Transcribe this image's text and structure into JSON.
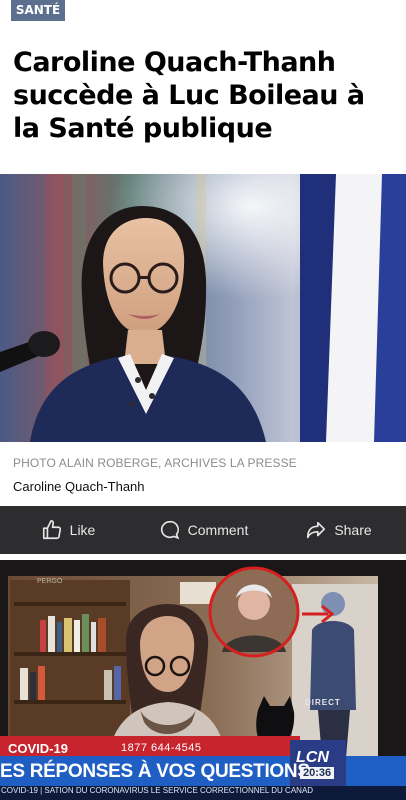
{
  "article": {
    "section_tag": "SANTÉ",
    "headline": "Caroline Quach-Thanh succède à Luc Boileau à la Santé publique",
    "photo_credit": "PHOTO ALAIN ROBERGE, ARCHIVES LA PRESSE",
    "photo_caption": "Caroline Quach-Thanh"
  },
  "social_bar": {
    "like_label": "Like",
    "comment_label": "Comment",
    "share_label": "Share",
    "icons": [
      "thumbs-up-icon",
      "speech-bubble-icon",
      "share-arrow-icon"
    ]
  },
  "video": {
    "top_label": "PERGO",
    "direct_label": "DIRECT",
    "channel_label": "LCN",
    "topic_tag": "COVID-19",
    "phone": "1877 644-4545",
    "headline": "ES RÉPONSES À VOS QUESTIONS",
    "time": "20:36",
    "bottom_ticker": "COVID-19 | SATION DU CORONAVIRUS  LE SERVICE CORRECTIONNEL DU CANAD"
  },
  "colors": {
    "tag_bg": "#5d6f8e",
    "bar_bg": "#2d2d30",
    "ticker_red": "#c8242e",
    "ticker_blue": "#1f5fc4",
    "circle_red": "#d62020"
  }
}
